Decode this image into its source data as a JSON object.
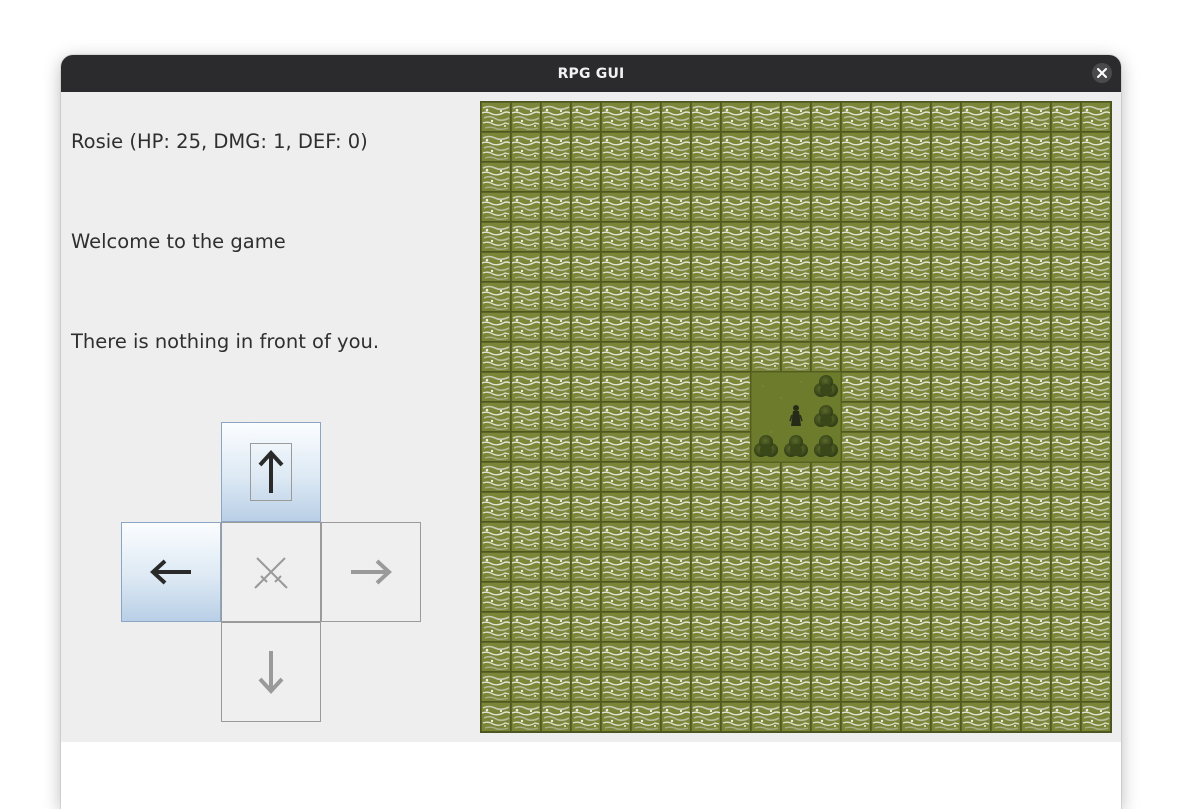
{
  "window": {
    "title": "RPG GUI"
  },
  "player": {
    "stats": "Rosie (HP: 25, DMG: 1, DEF: 0)"
  },
  "messages": {
    "welcome": "Welcome to the game",
    "surroundings": "There is nothing in front of you."
  },
  "controls": {
    "up": {
      "icon": "arrow-up-icon",
      "glyph": "🡑",
      "enabled": true
    },
    "left": {
      "icon": "arrow-left-icon",
      "glyph": "🡐",
      "enabled": true
    },
    "attack": {
      "icon": "crossed-swords-icon",
      "glyph": "⚔",
      "enabled": false
    },
    "right": {
      "icon": "arrow-right-icon",
      "glyph": "🡒",
      "enabled": false
    },
    "down": {
      "icon": "arrow-down-icon",
      "glyph": "🡓",
      "enabled": false
    }
  },
  "map": {
    "grid_size": 21,
    "terrain": "rocky",
    "revealed_area": {
      "col_from": 9,
      "col_to": 11,
      "row_from": 9,
      "row_to": 11
    },
    "player_tile": {
      "col": 10,
      "row": 10
    },
    "bush_tiles": [
      [
        11,
        9
      ],
      [
        11,
        10
      ],
      [
        9,
        11
      ],
      [
        10,
        11
      ],
      [
        11,
        11
      ]
    ],
    "colors": {
      "rock": "#6f7a32",
      "grass": "#6d7b2c",
      "bush": "#3d4a1c",
      "active_button": "#c7d9ec"
    }
  }
}
